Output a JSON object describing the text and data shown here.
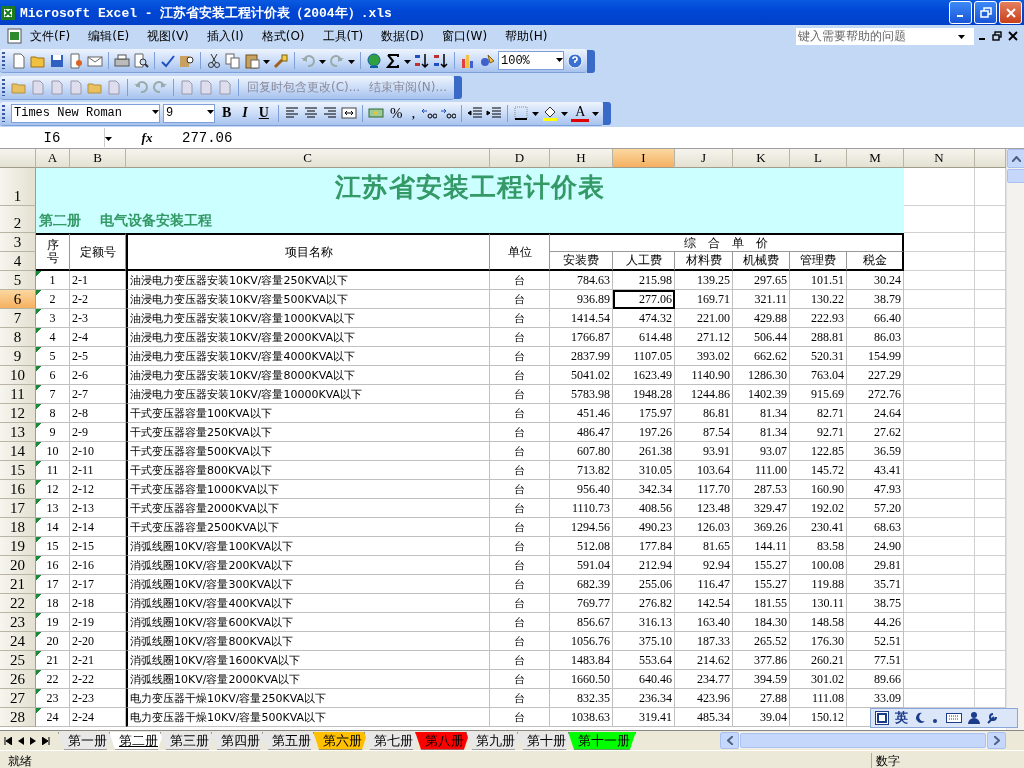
{
  "window": {
    "title": "Microsoft Excel - 江苏省安装工程计价表（2004年）.xls"
  },
  "menu": [
    "文件(F)",
    "编辑(E)",
    "视图(V)",
    "插入(I)",
    "格式(O)",
    "工具(T)",
    "数据(D)",
    "窗口(W)",
    "帮助(H)"
  ],
  "help_box": {
    "placeholder": "键入需要帮助的问题"
  },
  "standard_toolbar": {
    "zoom": "100%"
  },
  "reviewing_toolbar": {
    "items": [
      {
        "label": "回复时包含更改(C)...",
        "disabled": true
      },
      {
        "label": "结束审阅(N)...",
        "disabled": true
      }
    ]
  },
  "formatting_toolbar": {
    "font": "Times New Roman",
    "size": "9",
    "style_buttons": [
      "B",
      "I",
      "U"
    ],
    "number_buttons": [
      "%",
      ","
    ],
    "font_color_button": "A"
  },
  "formula_bar": {
    "name_box": "I6",
    "function_label": "fx",
    "value": "277.06"
  },
  "sheet": {
    "columns": [
      {
        "label": "A",
        "selected": false
      },
      {
        "label": "B",
        "selected": false
      },
      {
        "label": "C",
        "selected": false
      },
      {
        "label": "D",
        "selected": false
      },
      {
        "label": "H",
        "selected": false
      },
      {
        "label": "I",
        "selected": true
      },
      {
        "label": "J",
        "selected": false
      },
      {
        "label": "K",
        "selected": false
      },
      {
        "label": "L",
        "selected": false
      },
      {
        "label": "M",
        "selected": false
      },
      {
        "label": "N",
        "selected": false
      }
    ],
    "row_headers": [
      {
        "label": "1",
        "selected": false
      },
      {
        "label": "2",
        "selected": false
      },
      {
        "label": "3",
        "selected": false
      },
      {
        "label": "4",
        "selected": false
      },
      {
        "label": "5",
        "selected": false
      },
      {
        "label": "6",
        "selected": true
      },
      {
        "label": "7",
        "selected": false
      },
      {
        "label": "8",
        "selected": false
      },
      {
        "label": "9",
        "selected": false
      },
      {
        "label": "10",
        "selected": false
      },
      {
        "label": "11",
        "selected": false
      },
      {
        "label": "12",
        "selected": false
      },
      {
        "label": "13",
        "selected": false
      },
      {
        "label": "14",
        "selected": false
      },
      {
        "label": "15",
        "selected": false
      },
      {
        "label": "16",
        "selected": false
      },
      {
        "label": "17",
        "selected": false
      },
      {
        "label": "18",
        "selected": false
      },
      {
        "label": "19",
        "selected": false
      },
      {
        "label": "20",
        "selected": false
      },
      {
        "label": "21",
        "selected": false
      },
      {
        "label": "22",
        "selected": false
      },
      {
        "label": "23",
        "selected": false
      },
      {
        "label": "24",
        "selected": false
      },
      {
        "label": "25",
        "selected": false
      },
      {
        "label": "26",
        "selected": false
      },
      {
        "label": "27",
        "selected": false
      },
      {
        "label": "28",
        "selected": false
      }
    ],
    "title": "江苏省安装工程计价表",
    "subtitle": "第二册    电气设备安装工程",
    "header": {
      "seq": "序号",
      "code": "定额号",
      "name": "项目名称",
      "unit": "单位",
      "group": "综　合　单　价",
      "costs": [
        "安装费",
        "人工费",
        "材料费",
        "机械费",
        "管理费",
        "税金"
      ]
    },
    "rows": [
      {
        "seq": "1",
        "code": "2-1",
        "name": "油浸电力变压器安装10KV/容量250KVA以下",
        "unit": "台",
        "h": "784.63",
        "i": "215.98",
        "j": "139.25",
        "k": "297.65",
        "l": "101.51",
        "m": "30.24"
      },
      {
        "seq": "2",
        "code": "2-2",
        "name": "油浸电力变压器安装10KV/容量500KVA以下",
        "unit": "台",
        "h": "936.89",
        "i": "277.06",
        "j": "169.71",
        "k": "321.11",
        "l": "130.22",
        "m": "38.79"
      },
      {
        "seq": "3",
        "code": "2-3",
        "name": "油浸电力变压器安装10KV/容量1000KVA以下",
        "unit": "台",
        "h": "1414.54",
        "i": "474.32",
        "j": "221.00",
        "k": "429.88",
        "l": "222.93",
        "m": "66.40"
      },
      {
        "seq": "4",
        "code": "2-4",
        "name": "油浸电力变压器安装10KV/容量2000KVA以下",
        "unit": "台",
        "h": "1766.87",
        "i": "614.48",
        "j": "271.12",
        "k": "506.44",
        "l": "288.81",
        "m": "86.03"
      },
      {
        "seq": "5",
        "code": "2-5",
        "name": "油浸电力变压器安装10KV/容量4000KVA以下",
        "unit": "台",
        "h": "2837.99",
        "i": "1107.05",
        "j": "393.02",
        "k": "662.62",
        "l": "520.31",
        "m": "154.99"
      },
      {
        "seq": "6",
        "code": "2-6",
        "name": "油浸电力变压器安装10KV/容量8000KVA以下",
        "unit": "台",
        "h": "5041.02",
        "i": "1623.49",
        "j": "1140.90",
        "k": "1286.30",
        "l": "763.04",
        "m": "227.29"
      },
      {
        "seq": "7",
        "code": "2-7",
        "name": "油浸电力变压器安装10KV/容量10000KVA以下",
        "unit": "台",
        "h": "5783.98",
        "i": "1948.28",
        "j": "1244.86",
        "k": "1402.39",
        "l": "915.69",
        "m": "272.76"
      },
      {
        "seq": "8",
        "code": "2-8",
        "name": "干式变压器容量100KVA以下",
        "unit": "台",
        "h": "451.46",
        "i": "175.97",
        "j": "86.81",
        "k": "81.34",
        "l": "82.71",
        "m": "24.64"
      },
      {
        "seq": "9",
        "code": "2-9",
        "name": "干式变压器容量250KVA以下",
        "unit": "台",
        "h": "486.47",
        "i": "197.26",
        "j": "87.54",
        "k": "81.34",
        "l": "92.71",
        "m": "27.62"
      },
      {
        "seq": "10",
        "code": "2-10",
        "name": "干式变压器容量500KVA以下",
        "unit": "台",
        "h": "607.80",
        "i": "261.38",
        "j": "93.91",
        "k": "93.07",
        "l": "122.85",
        "m": "36.59"
      },
      {
        "seq": "11",
        "code": "2-11",
        "name": "干式变压器容量800KVA以下",
        "unit": "台",
        "h": "713.82",
        "i": "310.05",
        "j": "103.64",
        "k": "111.00",
        "l": "145.72",
        "m": "43.41"
      },
      {
        "seq": "12",
        "code": "2-12",
        "name": "干式变压器容量1000KVA以下",
        "unit": "台",
        "h": "956.40",
        "i": "342.34",
        "j": "117.70",
        "k": "287.53",
        "l": "160.90",
        "m": "47.93"
      },
      {
        "seq": "13",
        "code": "2-13",
        "name": "干式变压器容量2000KVA以下",
        "unit": "台",
        "h": "1110.73",
        "i": "408.56",
        "j": "123.48",
        "k": "329.47",
        "l": "192.02",
        "m": "57.20"
      },
      {
        "seq": "14",
        "code": "2-14",
        "name": "干式变压器容量2500KVA以下",
        "unit": "台",
        "h": "1294.56",
        "i": "490.23",
        "j": "126.03",
        "k": "369.26",
        "l": "230.41",
        "m": "68.63"
      },
      {
        "seq": "15",
        "code": "2-15",
        "name": "消弧线圈10KV/容量100KVA以下",
        "unit": "台",
        "h": "512.08",
        "i": "177.84",
        "j": "81.65",
        "k": "144.11",
        "l": "83.58",
        "m": "24.90"
      },
      {
        "seq": "16",
        "code": "2-16",
        "name": "消弧线圈10KV/容量200KVA以下",
        "unit": "台",
        "h": "591.04",
        "i": "212.94",
        "j": "92.94",
        "k": "155.27",
        "l": "100.08",
        "m": "29.81"
      },
      {
        "seq": "17",
        "code": "2-17",
        "name": "消弧线圈10KV/容量300KVA以下",
        "unit": "台",
        "h": "682.39",
        "i": "255.06",
        "j": "116.47",
        "k": "155.27",
        "l": "119.88",
        "m": "35.71"
      },
      {
        "seq": "18",
        "code": "2-18",
        "name": "消弧线圈10KV/容量400KVA以下",
        "unit": "台",
        "h": "769.77",
        "i": "276.82",
        "j": "142.54",
        "k": "181.55",
        "l": "130.11",
        "m": "38.75"
      },
      {
        "seq": "19",
        "code": "2-19",
        "name": "消弧线圈10KV/容量600KVA以下",
        "unit": "台",
        "h": "856.67",
        "i": "316.13",
        "j": "163.40",
        "k": "184.30",
        "l": "148.58",
        "m": "44.26"
      },
      {
        "seq": "20",
        "code": "2-20",
        "name": "消弧线圈10KV/容量800KVA以下",
        "unit": "台",
        "h": "1056.76",
        "i": "375.10",
        "j": "187.33",
        "k": "265.52",
        "l": "176.30",
        "m": "52.51"
      },
      {
        "seq": "21",
        "code": "2-21",
        "name": "消弧线圈10KV/容量1600KVA以下",
        "unit": "台",
        "h": "1483.84",
        "i": "553.64",
        "j": "214.62",
        "k": "377.86",
        "l": "260.21",
        "m": "77.51"
      },
      {
        "seq": "22",
        "code": "2-22",
        "name": "消弧线圈10KV/容量2000KVA以下",
        "unit": "台",
        "h": "1660.50",
        "i": "640.46",
        "j": "234.77",
        "k": "394.59",
        "l": "301.02",
        "m": "89.66"
      },
      {
        "seq": "23",
        "code": "2-23",
        "name": "电力变压器干燥10KV/容量250KVA以下",
        "unit": "台",
        "h": "832.35",
        "i": "236.34",
        "j": "423.96",
        "k": "27.88",
        "l": "111.08",
        "m": "33.09"
      },
      {
        "seq": "24",
        "code": "2-24",
        "name": "电力变压器干燥10KV/容量500KVA以下",
        "unit": "台",
        "h": "1038.63",
        "i": "319.41",
        "j": "485.34",
        "k": "39.04",
        "l": "150.12"
      }
    ]
  },
  "sheet_tabs": [
    {
      "label": "第一册",
      "selected": false
    },
    {
      "label": "第二册",
      "selected": true
    },
    {
      "label": "第三册",
      "selected": false
    },
    {
      "label": "第四册",
      "selected": false
    },
    {
      "label": "第五册",
      "selected": false
    },
    {
      "label": "第六册",
      "selected": false,
      "color": "#ffc000"
    },
    {
      "label": "第七册",
      "selected": false
    },
    {
      "label": "第八册",
      "selected": false,
      "color": "#ff0000"
    },
    {
      "label": "第九册",
      "selected": false
    },
    {
      "label": "第十册",
      "selected": false
    },
    {
      "label": "第十一册",
      "selected": false,
      "color": "#00ff00"
    }
  ],
  "status_bar": {
    "left": "就绪",
    "right": "数字"
  },
  "ime_bar": {
    "label": "英"
  }
}
